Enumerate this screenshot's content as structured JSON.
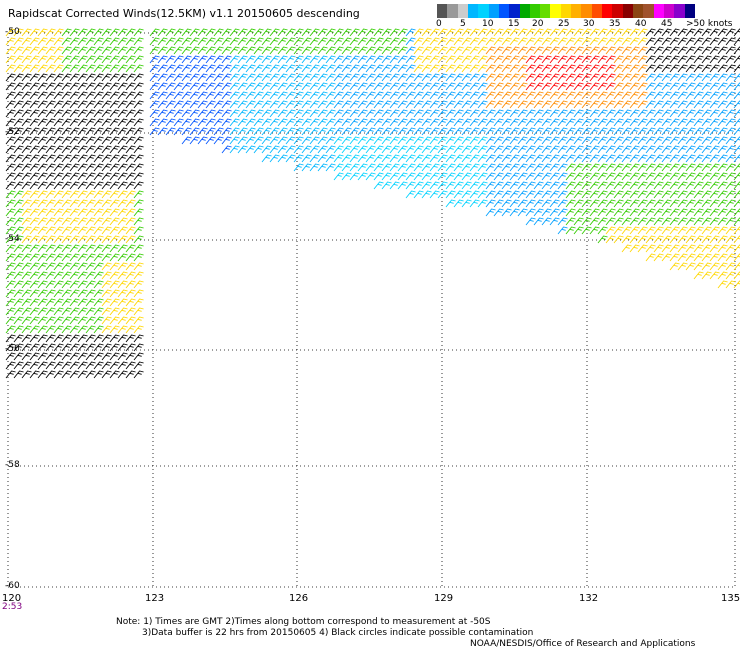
{
  "title": "Rapidscat Corrected Winds(12.5KM) v1.1 20150605 descending",
  "legend": {
    "colors": [
      "#555555",
      "#999999",
      "#cccccc",
      "#00b7ff",
      "#00d2ff",
      "#00a0ff",
      "#0055ff",
      "#0022cc",
      "#00aa00",
      "#33cc00",
      "#66dd00",
      "#ffff00",
      "#ffd700",
      "#ffb000",
      "#ff8c00",
      "#ff4d00",
      "#ff0000",
      "#cc0000",
      "#880000",
      "#8b4513",
      "#a0522d",
      "#ff00ff",
      "#cc00cc",
      "#8800cc",
      "#000080"
    ],
    "labels": [
      "0",
      "5",
      "10",
      "15",
      "20",
      "25",
      "30",
      "35",
      "40",
      "45",
      ">50 knots"
    ]
  },
  "axes": {
    "lat_labels": [
      "-50",
      "-52",
      "-54",
      "-56",
      "-58",
      "-60"
    ],
    "lon_labels": [
      "120",
      "123",
      "126",
      "129",
      "132",
      "135"
    ]
  },
  "time_label": "2:53",
  "notes": [
    "Note: 1) Times are GMT 2)Times along bottom correspond to measurement at -50S",
    "3)Data buffer is 22 hrs from 20150605 4) Black circles indicate possible contamination",
    "NOAA/NESDIS/Office of Research and Applications"
  ]
}
